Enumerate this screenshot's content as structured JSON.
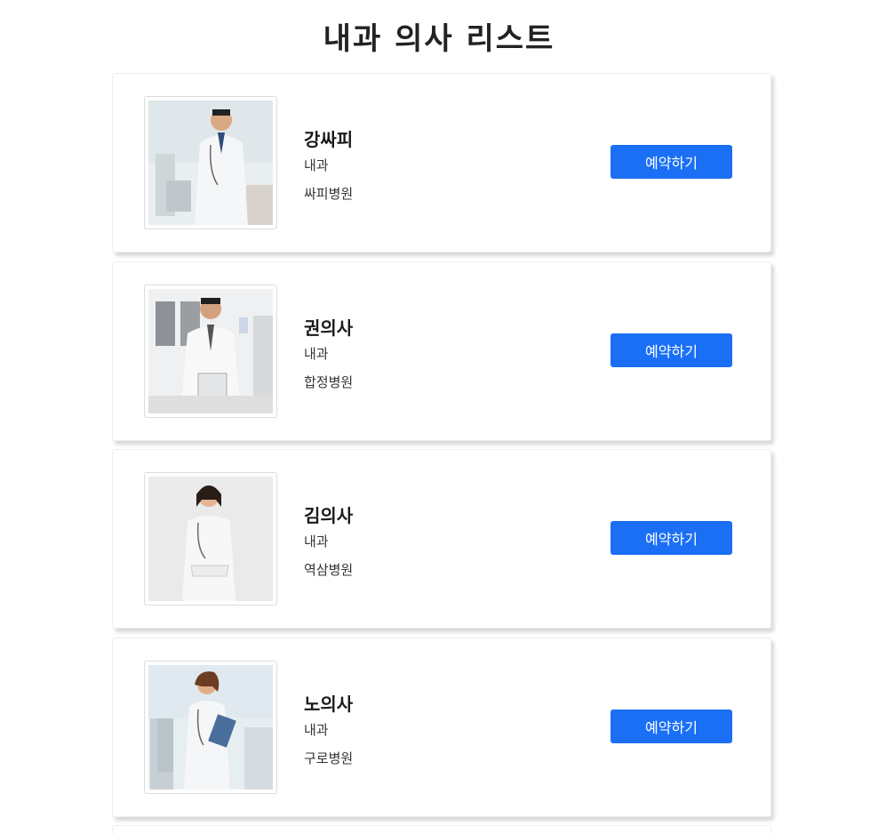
{
  "page": {
    "title": "내과 의사 리스트"
  },
  "doctors": [
    {
      "name": "강싸피",
      "department": "내과",
      "hospital": "싸피병원",
      "button_label": "예약하기",
      "photo_icon": "male-doctor-photo"
    },
    {
      "name": "권의사",
      "department": "내과",
      "hospital": "합정병원",
      "button_label": "예약하기",
      "photo_icon": "male-doctor-photo"
    },
    {
      "name": "김의사",
      "department": "내과",
      "hospital": "역삼병원",
      "button_label": "예약하기",
      "photo_icon": "female-doctor-photo"
    },
    {
      "name": "노의사",
      "department": "내과",
      "hospital": "구로병원",
      "button_label": "예약하기",
      "photo_icon": "female-doctor-photo"
    }
  ],
  "colors": {
    "button": "#1a6ff5",
    "button_text": "#ffffff"
  }
}
